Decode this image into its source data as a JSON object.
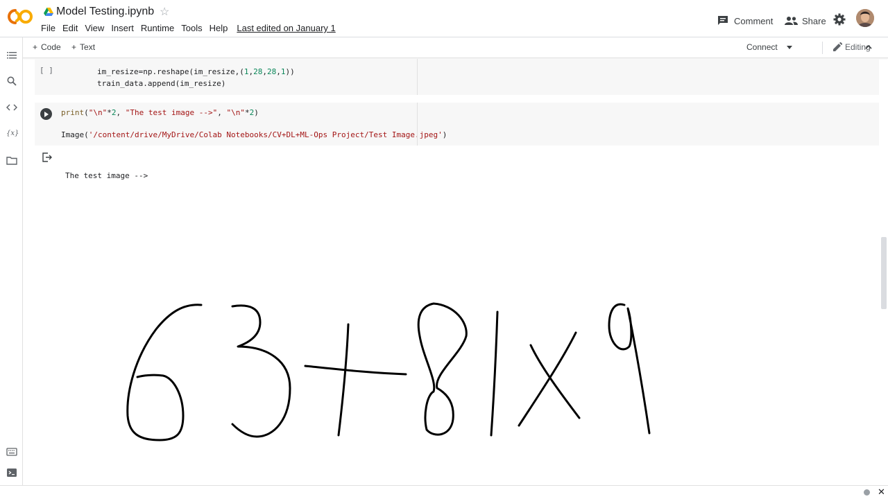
{
  "app": {
    "logo_text": "CO",
    "notebook_title": "Model Testing.ipynb"
  },
  "menu": {
    "items": [
      "File",
      "Edit",
      "View",
      "Insert",
      "Runtime",
      "Tools",
      "Help"
    ],
    "last_edited": "Last edited on January 1"
  },
  "header_actions": {
    "comment_label": "Comment",
    "share_label": "Share"
  },
  "toolbar": {
    "add_code_label": "Code",
    "add_text_label": "Text",
    "connect_label": "Connect",
    "editing_label": "Editing"
  },
  "cells": {
    "cell1": {
      "exec_label": "[ ]",
      "line1_a": "im_resize=np.reshape(im_resize,(",
      "line1_n1": "1",
      "line1_c1": ",",
      "line1_n2": "28",
      "line1_c2": ",",
      "line1_n3": "28",
      "line1_c3": ",",
      "line1_n4": "1",
      "line1_b": "))",
      "line2": "train_data.append(im_resize)"
    },
    "cell2": {
      "l1_fn": "print",
      "l1_p1": "(",
      "l1_s1": "\"\\n\"",
      "l1_op1": "*",
      "l1_n1": "2",
      "l1_c1": ", ",
      "l1_s2": "\"The test image -->\"",
      "l1_c2": ", ",
      "l1_s3": "\"\\n\"",
      "l1_op2": "*",
      "l1_n2": "2",
      "l1_p2": ")",
      "l2_fn": "Image(",
      "l2_str": "'/content/drive/MyDrive/Colab Notebooks/CV+DL+ML-Ops Project/Test Image.jpeg'",
      "l2_end": ")"
    }
  },
  "output": {
    "text": "The test image -->"
  },
  "colors": {
    "accent": "#f9ab00",
    "logo_orange": "#e8710a",
    "run_button": "#3c4043"
  }
}
